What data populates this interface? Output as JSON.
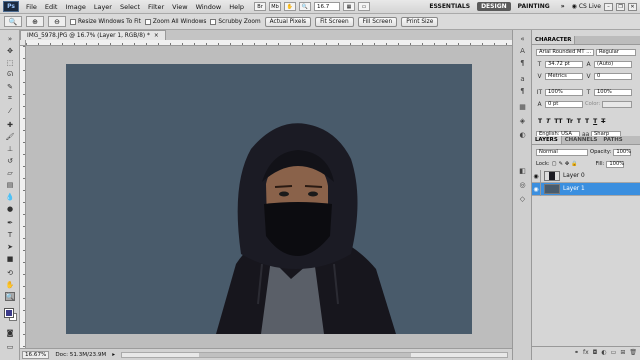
{
  "menubar": {
    "logo": "Ps",
    "items": [
      "File",
      "Edit",
      "Image",
      "Layer",
      "Select",
      "Filter",
      "View",
      "Window",
      "Help"
    ],
    "zoom": "16.7",
    "workspaces": [
      "ESSENTIALS",
      "DESIGN",
      "PAINTING"
    ],
    "active_workspace": "DESIGN",
    "cs_live": "CS Live",
    "more": "»"
  },
  "options_bar": {
    "resize_windows": "Resize Windows To Fit",
    "zoom_all": "Zoom All Windows",
    "scrubby": "Scrubby Zoom",
    "actual_pixels": "Actual Pixels",
    "fit_screen": "Fit Screen",
    "fill_screen": "Fill Screen",
    "print_size": "Print Size"
  },
  "document": {
    "tab_title": "IMG_5978.JPG @ 16.7% (Layer 1, RGB/8) *",
    "close": "×"
  },
  "status": {
    "zoom": "16.67%",
    "doc": "Doc: 51.3M/23.9M"
  },
  "character": {
    "tabs": [
      "CHARACTER"
    ],
    "font_family": "Arial Rounded MT ...",
    "font_style": "Regular",
    "size": "34.72 pt",
    "leading": "(Auto)",
    "kerning": "Metrics",
    "tracking": "0",
    "vscale": "100%",
    "hscale": "100%",
    "baseline": "0 pt",
    "color_label": "Color:",
    "language": "English: USA",
    "antialias": "Sharp",
    "aa_label": "aa",
    "style_buttons": [
      "T",
      "T",
      "TT",
      "Tr",
      "T",
      "T",
      "T",
      "T"
    ]
  },
  "layers": {
    "tabs": [
      "LAYERS",
      "CHANNELS",
      "PATHS"
    ],
    "blend_mode": "Normal",
    "opacity_label": "Opacity:",
    "opacity": "100%",
    "lock_label": "Lock:",
    "fill_label": "Fill:",
    "fill": "100%",
    "items": [
      {
        "name": "Layer 0",
        "selected": false
      },
      {
        "name": "Layer 1",
        "selected": true
      }
    ]
  },
  "colors": {
    "accent": "#3b8fdf",
    "backdrop": "#495b6b",
    "foreground_swatch": "#3b3a8a"
  }
}
